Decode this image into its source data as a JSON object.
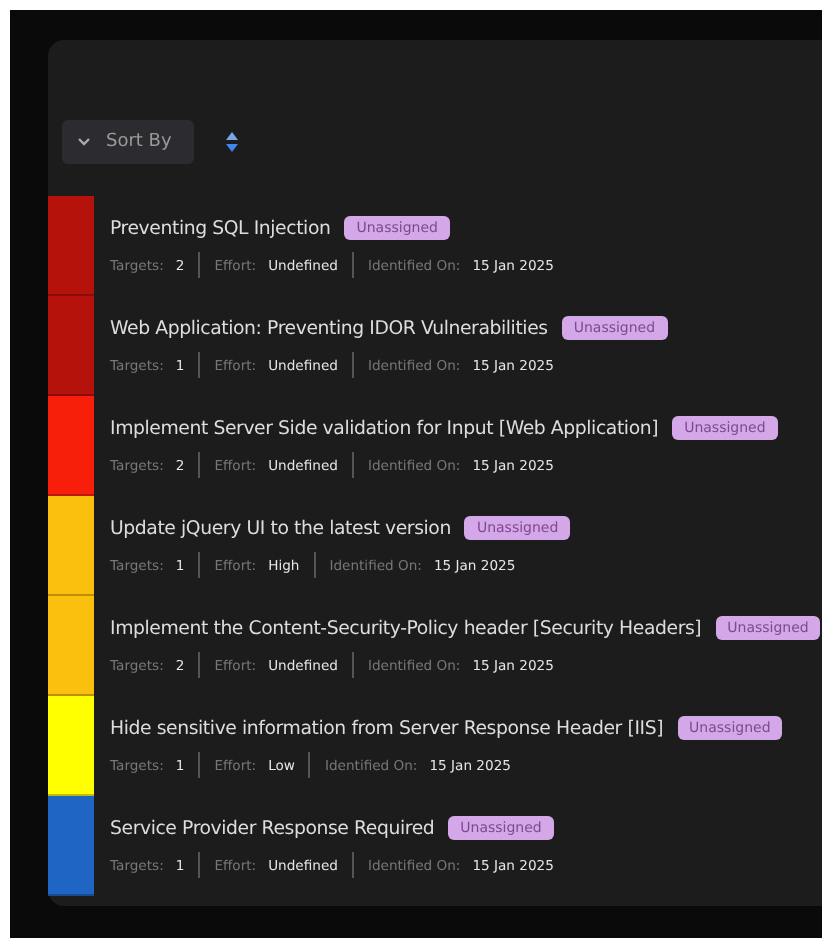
{
  "toolbar": {
    "sort_button": "Sort By"
  },
  "findings": [
    {
      "title": "Preventing SQL Injection",
      "status": "Unassigned",
      "color": "#b5120b",
      "targets_label": "Targets:",
      "targets": "2",
      "effort_label": "Effort:",
      "effort": "Undefined",
      "identified_label": "Identified On:",
      "identified": "15 Jan 2025"
    },
    {
      "title": "Web Application: Preventing IDOR Vulnerabilities",
      "status": "Unassigned",
      "color": "#b5120b",
      "targets_label": "Targets:",
      "targets": "1",
      "effort_label": "Effort:",
      "effort": "Undefined",
      "identified_label": "Identified On:",
      "identified": "15 Jan 2025"
    },
    {
      "title": "Implement Server Side validation for Input [Web Application]",
      "status": "Unassigned",
      "color": "#f71f0a",
      "targets_label": "Targets:",
      "targets": "2",
      "effort_label": "Effort:",
      "effort": "Undefined",
      "identified_label": "Identified On:",
      "identified": "15 Jan 2025"
    },
    {
      "title": "Update jQuery UI to the latest version",
      "status": "Unassigned",
      "color": "#fbbf0d",
      "targets_label": "Targets:",
      "targets": "1",
      "effort_label": "Effort:",
      "effort": "High",
      "identified_label": "Identified On:",
      "identified": "15 Jan 2025"
    },
    {
      "title": "Implement the Content-Security-Policy header [Security Headers]",
      "status": "Unassigned",
      "color": "#fbbf0d",
      "targets_label": "Targets:",
      "targets": "2",
      "effort_label": "Effort:",
      "effort": "Undefined",
      "identified_label": "Identified On:",
      "identified": "15 Jan 2025"
    },
    {
      "title": "Hide sensitive information from Server Response Header [IIS]",
      "status": "Unassigned",
      "color": "#ffff00",
      "targets_label": "Targets:",
      "targets": "1",
      "effort_label": "Effort:",
      "effort": "Low",
      "identified_label": "Identified On:",
      "identified": "15 Jan 2025"
    },
    {
      "title": "Service Provider Response Required",
      "status": "Unassigned",
      "color": "#1f66c4",
      "targets_label": "Targets:",
      "targets": "1",
      "effort_label": "Effort:",
      "effort": "Undefined",
      "identified_label": "Identified On:",
      "identified": "15 Jan 2025"
    }
  ]
}
